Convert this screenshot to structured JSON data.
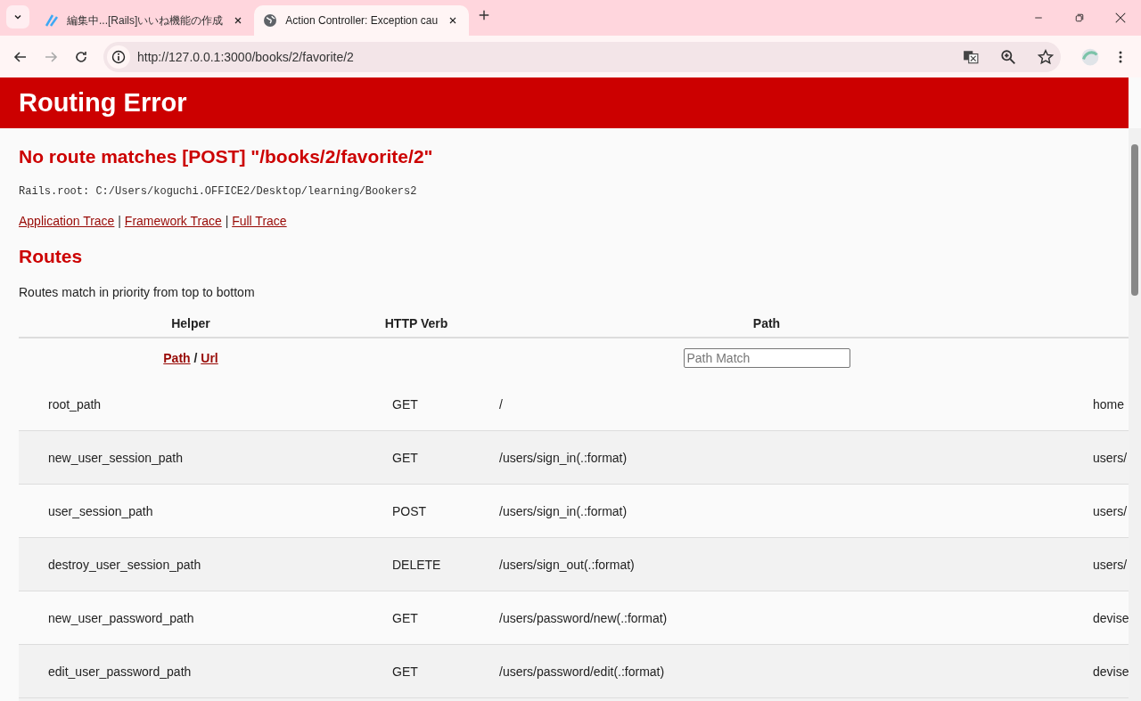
{
  "browser": {
    "tabs": [
      {
        "title": "編集中...[Rails]いいね機能の作成",
        "selected": false
      },
      {
        "title": "Action Controller: Exception cau",
        "selected": true
      }
    ],
    "address": "http://127.0.0.1:3000/books/2/favorite/2"
  },
  "header": {
    "title": "Routing Error"
  },
  "error": {
    "message": "No route matches [POST] \"/books/2/favorite/2\"",
    "rails_root": "Rails.root: C:/Users/koguchi.OFFICE2/Desktop/learning/Bookers2",
    "trace_links": [
      "Application Trace",
      "Framework Trace",
      "Full Trace"
    ],
    "trace_separators": [
      "|",
      "|"
    ]
  },
  "routes": {
    "title": "Routes",
    "note": "Routes match in priority from top to bottom",
    "columns": [
      "Helper",
      "HTTP Verb",
      "Path"
    ],
    "helper_links": [
      "Path",
      "Url"
    ],
    "helper_separator": "/",
    "filter": {
      "placeholder": "Path Match"
    },
    "rows": [
      {
        "helper": "root_path",
        "verb": "GET",
        "path": "/",
        "column_4": "home"
      },
      {
        "helper": "new_user_session_path",
        "verb": "GET",
        "path": "/users/sign_in(.:format)",
        "column_4": "users/"
      },
      {
        "helper": "user_session_path",
        "verb": "POST",
        "path": "/users/sign_in(.:format)",
        "column_4": "users/"
      },
      {
        "helper": "destroy_user_session_path",
        "verb": "DELETE",
        "path": "/users/sign_out(.:format)",
        "column_4": "users/"
      },
      {
        "helper": "new_user_password_path",
        "verb": "GET",
        "path": "/users/password/new(.:format)",
        "column_4": "devise"
      },
      {
        "helper": "edit_user_password_path",
        "verb": "GET",
        "path": "/users/password/edit(.:format)",
        "column_4": "devise"
      }
    ]
  }
}
